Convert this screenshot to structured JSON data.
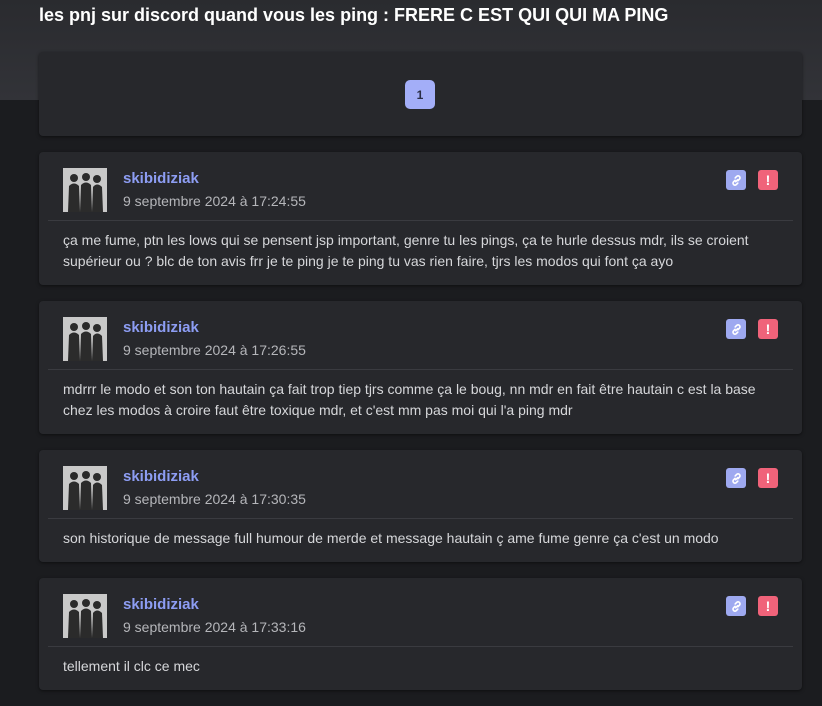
{
  "topic": {
    "title": "les pnj sur discord quand vous les ping : FRERE C EST QUI QUI MA PING"
  },
  "pagination": {
    "current_page": "1"
  },
  "messages": [
    {
      "author": "skibidiziak",
      "date": "9 septembre 2024 à 17:24:55",
      "text": "ça me fume, ptn les lows qui se pensent jsp important, genre tu les pings, ça te hurle dessus mdr, ils se croient supérieur ou ? blc de ton avis frr je te ping je te ping tu vas rien faire, tjrs les modos qui font ça ayo"
    },
    {
      "author": "skibidiziak",
      "date": "9 septembre 2024 à 17:26:55",
      "text": "mdrrr le modo et son ton hautain ça fait trop tiep tjrs comme ça le boug, nn mdr en fait être hautain c est la base chez les modos à croire faut être toxique mdr, et c'est mm pas moi qui l'a ping mdr"
    },
    {
      "author": "skibidiziak",
      "date": "9 septembre 2024 à 17:30:35",
      "text": "son historique de message full humour de merde et message hautain ç ame fume genre ça c'est un modo"
    },
    {
      "author": "skibidiziak",
      "date": "9 septembre 2024 à 17:33:16",
      "text": "tellement il clc ce mec"
    }
  ],
  "icons": {
    "link": "link-icon",
    "report": "exclamation-icon"
  },
  "colors": {
    "accent": "#8d9df3",
    "page_button": "#a3aef8",
    "link_button": "#9ea9f0",
    "report_button": "#f0637a",
    "card_bg": "#27282c",
    "page_bg": "#1b1c1f"
  }
}
